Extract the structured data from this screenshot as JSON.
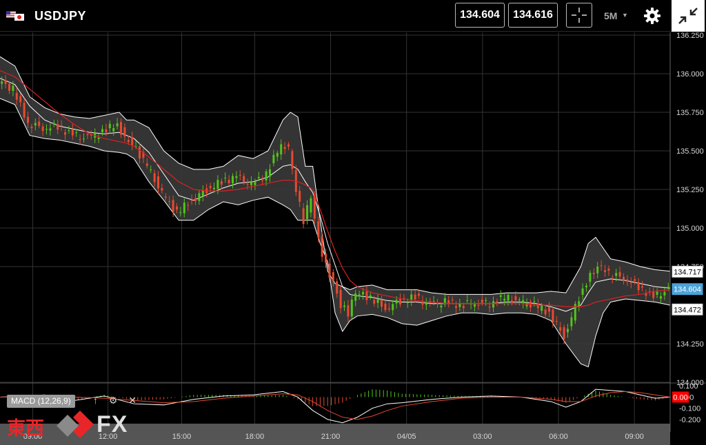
{
  "header": {
    "symbol": "USDJPY",
    "bid": "134.604",
    "ask": "134.616",
    "timeframe": "5M",
    "icons": [
      "flag-us-jp-icon",
      "crosshair-icon",
      "gear-icon",
      "collapse-icon"
    ]
  },
  "price_tags": {
    "upper": "134.717",
    "current": "134.604",
    "lower": "134.472",
    "macd_current": "0.00"
  },
  "indicator": {
    "label": "MACD (12,26,9)",
    "icons": [
      "arrow-up-icon",
      "gear-icon",
      "close-icon"
    ]
  },
  "logo": {
    "kanji": "東西",
    "text": "FX"
  },
  "colors": {
    "up": "#52c41a",
    "down": "#e84a2f",
    "sma": "#e02020",
    "band": "#ffffff",
    "current_tag": "#4ba3d8",
    "macd_tag": "#ff0000"
  },
  "chart_data": [
    {
      "type": "candlestick",
      "symbol": "USDJPY",
      "timeframe": "5M",
      "ylim": [
        134.0,
        136.25
      ],
      "y_ticks": [
        "136.250",
        "136.000",
        "135.750",
        "135.500",
        "135.250",
        "135.000",
        "134.750",
        "134.250",
        "134.000"
      ],
      "x_ticks": [
        "09:00",
        "12:00",
        "15:00",
        "18:00",
        "21:00",
        "04/05",
        "03:00",
        "06:00",
        "09:00"
      ],
      "indicators": [
        "Bollinger Bands",
        "Moving Average"
      ],
      "series": [
        {
          "name": "close",
          "x": [
            0,
            2,
            4,
            6,
            8,
            10,
            12,
            14,
            16,
            17,
            18,
            20,
            22,
            24,
            26,
            28,
            30,
            32,
            34,
            36,
            38,
            39,
            40,
            41,
            42,
            43,
            44,
            45,
            46,
            47,
            48,
            50,
            52,
            54,
            56,
            58,
            60,
            62,
            64,
            66,
            68,
            70,
            72,
            74,
            76,
            78,
            79,
            80,
            81,
            82,
            84,
            86,
            88,
            90
          ],
          "values": [
            135.95,
            135.9,
            135.68,
            135.65,
            135.66,
            135.6,
            135.58,
            135.62,
            135.68,
            135.58,
            135.55,
            135.4,
            135.22,
            135.1,
            135.18,
            135.25,
            135.3,
            135.33,
            135.28,
            135.35,
            135.55,
            135.52,
            135.25,
            135.05,
            135.2,
            134.92,
            134.75,
            134.65,
            134.5,
            134.45,
            134.58,
            134.55,
            134.48,
            134.53,
            134.55,
            134.5,
            134.52,
            134.5,
            134.52,
            134.51,
            134.55,
            134.52,
            134.5,
            134.45,
            134.3,
            134.55,
            134.65,
            134.72,
            134.75,
            134.7,
            134.68,
            134.62,
            134.55,
            134.6
          ]
        },
        {
          "name": "bb_upper",
          "x": [
            0,
            2,
            4,
            6,
            8,
            10,
            12,
            14,
            16,
            17,
            18,
            20,
            22,
            24,
            26,
            28,
            30,
            32,
            34,
            36,
            38,
            39,
            40,
            41,
            42,
            43,
            44,
            45,
            46,
            47,
            48,
            50,
            52,
            54,
            56,
            58,
            60,
            62,
            64,
            66,
            68,
            70,
            72,
            74,
            76,
            78,
            79,
            80,
            81,
            82,
            84,
            86,
            88,
            90
          ],
          "values": [
            136.11,
            136.05,
            135.85,
            135.78,
            135.74,
            135.72,
            135.71,
            135.73,
            135.75,
            135.7,
            135.7,
            135.65,
            135.5,
            135.42,
            135.38,
            135.38,
            135.4,
            135.47,
            135.45,
            135.5,
            135.7,
            135.75,
            135.72,
            135.4,
            135.4,
            135.05,
            134.72,
            134.64,
            134.62,
            134.6,
            134.62,
            134.63,
            134.6,
            134.6,
            134.6,
            134.58,
            134.57,
            134.57,
            134.57,
            134.57,
            134.58,
            134.58,
            134.58,
            134.59,
            134.58,
            134.75,
            134.9,
            134.94,
            134.87,
            134.8,
            134.78,
            134.75,
            134.73,
            134.72
          ]
        },
        {
          "name": "bb_middle",
          "x": [
            0,
            2,
            4,
            6,
            8,
            10,
            12,
            14,
            16,
            17,
            18,
            20,
            22,
            24,
            26,
            28,
            30,
            32,
            34,
            36,
            38,
            39,
            40,
            41,
            42,
            43,
            44,
            45,
            46,
            47,
            48,
            50,
            52,
            54,
            56,
            58,
            60,
            62,
            64,
            66,
            68,
            70,
            72,
            74,
            76,
            78,
            79,
            80,
            81,
            82,
            84,
            86,
            88,
            90
          ],
          "values": [
            135.97,
            135.93,
            135.79,
            135.7,
            135.66,
            135.64,
            135.62,
            135.61,
            135.62,
            135.6,
            135.58,
            135.49,
            135.35,
            135.21,
            135.18,
            135.22,
            135.26,
            135.29,
            135.3,
            135.33,
            135.4,
            135.41,
            135.38,
            135.3,
            135.23,
            135.08,
            134.9,
            134.76,
            134.62,
            134.57,
            134.56,
            134.55,
            134.53,
            134.52,
            134.52,
            134.51,
            134.51,
            134.51,
            134.51,
            134.51,
            134.52,
            134.52,
            134.51,
            134.49,
            134.46,
            134.5,
            134.58,
            134.65,
            134.66,
            134.67,
            134.66,
            134.64,
            134.62,
            134.61
          ]
        },
        {
          "name": "bb_lower",
          "x": [
            0,
            2,
            4,
            6,
            8,
            10,
            12,
            14,
            16,
            17,
            18,
            20,
            22,
            24,
            26,
            28,
            30,
            32,
            34,
            36,
            38,
            39,
            40,
            41,
            42,
            43,
            44,
            45,
            46,
            47,
            48,
            50,
            52,
            54,
            56,
            58,
            60,
            62,
            64,
            66,
            68,
            70,
            72,
            74,
            76,
            78,
            79,
            80,
            81,
            82,
            84,
            86,
            88,
            90
          ],
          "values": [
            135.84,
            135.8,
            135.6,
            135.58,
            135.57,
            135.55,
            135.53,
            135.5,
            135.49,
            135.48,
            135.45,
            135.3,
            135.18,
            135.05,
            135.05,
            135.12,
            135.17,
            135.15,
            135.18,
            135.2,
            135.15,
            135.12,
            135.05,
            135.05,
            135.05,
            134.9,
            134.78,
            134.45,
            134.33,
            134.4,
            134.43,
            134.44,
            134.42,
            134.38,
            134.37,
            134.4,
            134.43,
            134.45,
            134.45,
            134.44,
            134.45,
            134.45,
            134.44,
            134.4,
            134.25,
            134.12,
            134.1,
            134.3,
            134.45,
            134.52,
            134.54,
            134.53,
            134.52,
            134.5
          ]
        },
        {
          "name": "moving_average",
          "x": [
            0,
            2,
            4,
            6,
            8,
            10,
            12,
            14,
            16,
            17,
            18,
            20,
            22,
            24,
            26,
            28,
            30,
            32,
            34,
            36,
            38,
            39,
            40,
            41,
            42,
            43,
            44,
            45,
            46,
            47,
            48,
            50,
            52,
            54,
            56,
            58,
            60,
            62,
            64,
            66,
            68,
            70,
            72,
            74,
            76,
            78,
            79,
            80,
            81,
            82,
            84,
            86,
            88,
            90
          ],
          "values": [
            136.02,
            135.98,
            135.9,
            135.82,
            135.74,
            135.67,
            135.61,
            135.58,
            135.56,
            135.55,
            135.53,
            135.46,
            135.38,
            135.3,
            135.25,
            135.24,
            135.24,
            135.25,
            135.27,
            135.29,
            135.31,
            135.31,
            135.3,
            135.28,
            135.25,
            135.12,
            134.98,
            134.85,
            134.74,
            134.66,
            134.62,
            134.58,
            134.56,
            134.54,
            134.53,
            134.52,
            134.51,
            134.51,
            134.51,
            134.51,
            134.51,
            134.51,
            134.5,
            134.5,
            134.49,
            134.49,
            134.5,
            134.52,
            134.53,
            134.54,
            134.56,
            134.57,
            134.59,
            134.6
          ]
        }
      ]
    },
    {
      "type": "line",
      "title": "MACD (12,26,9)",
      "ylim": [
        -0.25,
        0.12
      ],
      "y_ticks": [
        "0.100",
        "0.00",
        "-0.100",
        "-0.200"
      ],
      "series": [
        {
          "name": "macd",
          "x": [
            0,
            6,
            10,
            14,
            18,
            22,
            26,
            30,
            34,
            38,
            40,
            42,
            44,
            46,
            48,
            50,
            52,
            54,
            58,
            62,
            66,
            70,
            74,
            76,
            78,
            80,
            82,
            84,
            86,
            88,
            90
          ],
          "values": [
            0.0,
            0.02,
            -0.03,
            0.01,
            -0.06,
            -0.07,
            -0.02,
            0.01,
            0.02,
            0.05,
            0.0,
            -0.12,
            -0.2,
            -0.23,
            -0.18,
            -0.1,
            -0.06,
            -0.05,
            -0.02,
            0.0,
            0.01,
            0.0,
            -0.04,
            -0.09,
            -0.04,
            0.07,
            0.06,
            0.05,
            0.02,
            -0.01,
            0.0
          ]
        },
        {
          "name": "signal",
          "x": [
            0,
            6,
            10,
            14,
            18,
            22,
            26,
            30,
            34,
            38,
            40,
            42,
            44,
            46,
            48,
            50,
            52,
            54,
            58,
            62,
            66,
            70,
            74,
            76,
            78,
            80,
            82,
            84,
            86,
            88,
            90
          ],
          "values": [
            0.0,
            0.01,
            0.0,
            -0.01,
            -0.03,
            -0.05,
            -0.04,
            -0.01,
            0.01,
            0.03,
            0.02,
            -0.04,
            -0.12,
            -0.18,
            -0.2,
            -0.17,
            -0.12,
            -0.08,
            -0.04,
            -0.01,
            0.0,
            0.0,
            -0.02,
            -0.04,
            -0.04,
            0.01,
            0.04,
            0.05,
            0.04,
            0.02,
            0.0
          ]
        }
      ]
    }
  ]
}
